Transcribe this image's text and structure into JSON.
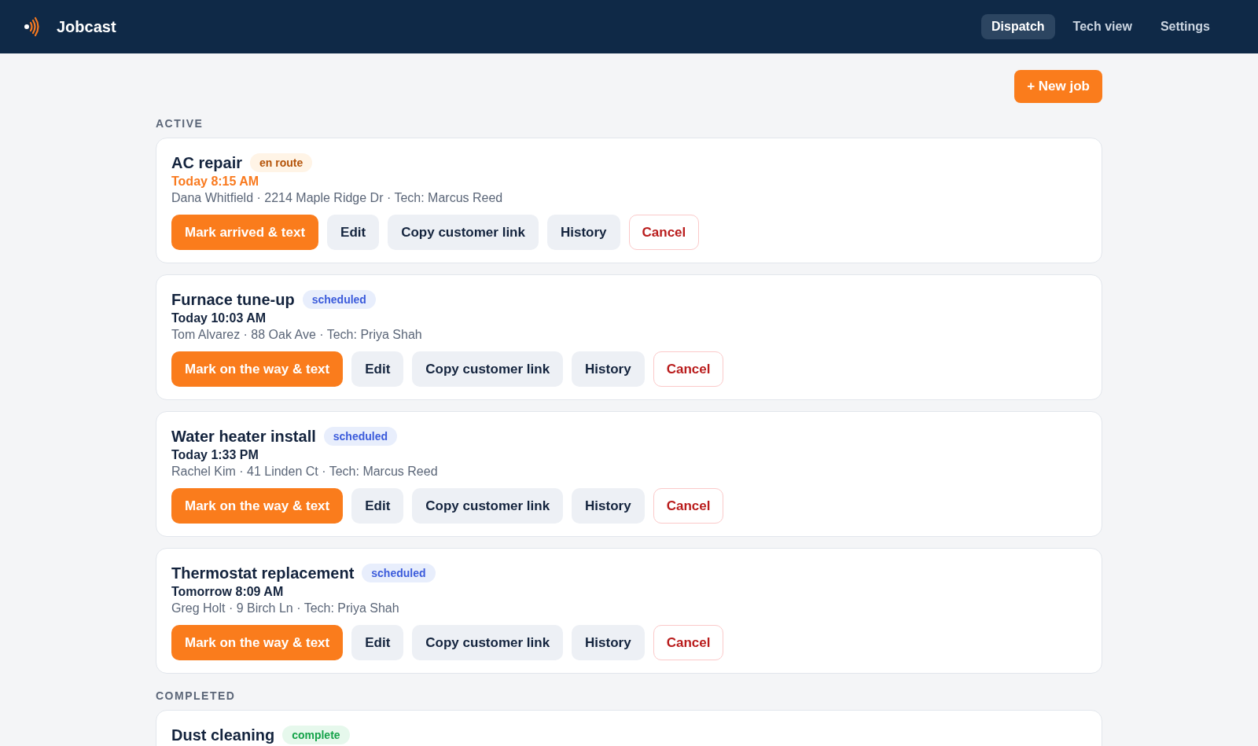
{
  "app": {
    "name": "Jobcast"
  },
  "nav": [
    {
      "label": "Dispatch",
      "selected": true
    },
    {
      "label": "Tech view",
      "selected": false
    },
    {
      "label": "Settings",
      "selected": false
    }
  ],
  "new_job_button": "+ New job",
  "sections": [
    {
      "heading": "ACTIVE",
      "jobs": [
        {
          "title": "AC repair",
          "status": {
            "label": "en route",
            "kind": "en_route"
          },
          "time": "Today 8:15 AM",
          "time_highlighted": true,
          "details": "Dana Whitfield · 2214 Maple Ridge Dr · Tech: Marcus Reed",
          "actions": [
            {
              "label": "Mark arrived & text",
              "kind": "primary"
            },
            {
              "label": "Edit",
              "kind": "secondary"
            },
            {
              "label": "Copy customer link",
              "kind": "secondary"
            },
            {
              "label": "History",
              "kind": "secondary"
            },
            {
              "label": "Cancel",
              "kind": "danger"
            }
          ]
        },
        {
          "title": "Furnace tune-up",
          "status": {
            "label": "scheduled",
            "kind": "scheduled"
          },
          "time": "Today 10:03 AM",
          "time_highlighted": false,
          "details": "Tom Alvarez · 88 Oak Ave · Tech: Priya Shah",
          "actions": [
            {
              "label": "Mark on the way & text",
              "kind": "primary"
            },
            {
              "label": "Edit",
              "kind": "secondary"
            },
            {
              "label": "Copy customer link",
              "kind": "secondary"
            },
            {
              "label": "History",
              "kind": "secondary"
            },
            {
              "label": "Cancel",
              "kind": "danger"
            }
          ]
        },
        {
          "title": "Water heater install",
          "status": {
            "label": "scheduled",
            "kind": "scheduled"
          },
          "time": "Today 1:33 PM",
          "time_highlighted": false,
          "details": "Rachel Kim · 41 Linden Ct · Tech: Marcus Reed",
          "actions": [
            {
              "label": "Mark on the way & text",
              "kind": "primary"
            },
            {
              "label": "Edit",
              "kind": "secondary"
            },
            {
              "label": "Copy customer link",
              "kind": "secondary"
            },
            {
              "label": "History",
              "kind": "secondary"
            },
            {
              "label": "Cancel",
              "kind": "danger"
            }
          ]
        },
        {
          "title": "Thermostat replacement",
          "status": {
            "label": "scheduled",
            "kind": "scheduled"
          },
          "time": "Tomorrow 8:09 AM",
          "time_highlighted": false,
          "details": "Greg Holt · 9 Birch Ln · Tech: Priya Shah",
          "actions": [
            {
              "label": "Mark on the way & text",
              "kind": "primary"
            },
            {
              "label": "Edit",
              "kind": "secondary"
            },
            {
              "label": "Copy customer link",
              "kind": "secondary"
            },
            {
              "label": "History",
              "kind": "secondary"
            },
            {
              "label": "Cancel",
              "kind": "danger"
            }
          ]
        }
      ]
    },
    {
      "heading": "COMPLETED",
      "jobs": [
        {
          "title": "Dust cleaning",
          "status": {
            "label": "complete",
            "kind": "complete"
          }
        }
      ]
    }
  ]
}
